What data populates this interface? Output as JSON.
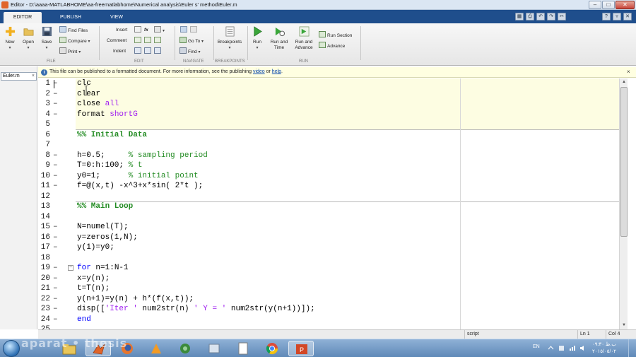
{
  "window": {
    "title": "Editor - D:\\aaaa-MATLABHOME\\aa-freematlabhome\\Numerical analysis\\Euler s' method\\Euler.m",
    "min_glyph": "–",
    "max_glyph": "□",
    "close_glyph": "✕"
  },
  "ribbon": {
    "tabs": [
      "EDITOR",
      "PUBLISH",
      "VIEW"
    ],
    "active_tab": "EDITOR",
    "quick_access_glyphs": [
      "▦",
      "⎙",
      "↶",
      "↷",
      "✂",
      "?",
      "▿",
      "✕"
    ],
    "file": {
      "group_label": "FILE",
      "new": "New",
      "open": "Open",
      "save": "Save",
      "find_files": "Find Files",
      "compare": "Compare",
      "print": "Print"
    },
    "edit": {
      "group_label": "EDIT",
      "insert": "Insert",
      "comment": "Comment",
      "indent": "Indent",
      "fx_glyph": "fx"
    },
    "navigate": {
      "group_label": "NAVIGATE",
      "go_to": "Go To",
      "find": "Find"
    },
    "breakpoints": {
      "group_label": "BREAKPOINTS",
      "breakpoints": "Breakpoints"
    },
    "run": {
      "group_label": "RUN",
      "run": "Run",
      "run_and_time": [
        "Run and",
        "Time"
      ],
      "run_and_advance": [
        "Run and",
        "Advance"
      ],
      "run_section": "Run Section",
      "advance": "Advance"
    },
    "caret": "▾"
  },
  "file_tab": {
    "name": "Euler.m",
    "close": "×"
  },
  "info_bar": {
    "text_before": "This file can be published to a formatted document. For more information, see the publishing ",
    "link1": "video",
    "middle": " or ",
    "link2": "help",
    "end": ".",
    "icon": "i",
    "close": "×"
  },
  "editor": {
    "dash": "–",
    "fold_glyph": "−",
    "lines": [
      {
        "n": "1",
        "dash": true,
        "segs": [
          {
            "t": "clc",
            "c": ""
          }
        ]
      },
      {
        "n": "2",
        "dash": true,
        "segs": [
          {
            "t": "clear",
            "c": ""
          }
        ]
      },
      {
        "n": "3",
        "dash": true,
        "segs": [
          {
            "t": "close ",
            "c": ""
          },
          {
            "t": "all",
            "c": "st"
          }
        ]
      },
      {
        "n": "4",
        "dash": true,
        "segs": [
          {
            "t": "format ",
            "c": ""
          },
          {
            "t": "shortG",
            "c": "st"
          }
        ]
      },
      {
        "n": "5",
        "dash": false,
        "segs": []
      },
      {
        "n": "6",
        "dash": false,
        "segs": [
          {
            "t": "%% Initial Data",
            "c": "sec"
          }
        ]
      },
      {
        "n": "7",
        "dash": false,
        "segs": []
      },
      {
        "n": "8",
        "dash": true,
        "segs": [
          {
            "t": "h=0.5;     ",
            "c": ""
          },
          {
            "t": "% sampling period",
            "c": "cm"
          }
        ]
      },
      {
        "n": "9",
        "dash": true,
        "segs": [
          {
            "t": "T=0:h:100; ",
            "c": ""
          },
          {
            "t": "% t",
            "c": "cm"
          }
        ]
      },
      {
        "n": "10",
        "dash": true,
        "segs": [
          {
            "t": "y0=1;      ",
            "c": ""
          },
          {
            "t": "% initial point",
            "c": "cm"
          }
        ]
      },
      {
        "n": "11",
        "dash": true,
        "segs": [
          {
            "t": "f=@(x,t) -x^3+x*sin( 2*t );",
            "c": ""
          }
        ]
      },
      {
        "n": "12",
        "dash": false,
        "segs": []
      },
      {
        "n": "13",
        "dash": false,
        "segs": [
          {
            "t": "%% Main Loop",
            "c": "sec"
          }
        ]
      },
      {
        "n": "14",
        "dash": false,
        "segs": []
      },
      {
        "n": "15",
        "dash": true,
        "segs": [
          {
            "t": "N=numel(T);",
            "c": ""
          }
        ]
      },
      {
        "n": "16",
        "dash": true,
        "segs": [
          {
            "t": "y=zeros(1,N);",
            "c": ""
          }
        ]
      },
      {
        "n": "17",
        "dash": true,
        "segs": [
          {
            "t": "y(1)=y0;",
            "c": ""
          }
        ]
      },
      {
        "n": "18",
        "dash": false,
        "segs": []
      },
      {
        "n": "19",
        "dash": true,
        "fold": true,
        "segs": [
          {
            "t": "for",
            "c": "kw"
          },
          {
            "t": " n=1:N-1",
            "c": ""
          }
        ]
      },
      {
        "n": "20",
        "dash": true,
        "segs": [
          {
            "t": "x=y(n);",
            "c": ""
          }
        ]
      },
      {
        "n": "21",
        "dash": true,
        "segs": [
          {
            "t": "t=T(n);",
            "c": ""
          }
        ]
      },
      {
        "n": "22",
        "dash": true,
        "segs": [
          {
            "t": "y(n+1)=y(n) + h*(f(x,t));",
            "c": ""
          }
        ]
      },
      {
        "n": "23",
        "dash": true,
        "segs": [
          {
            "t": "disp(['Iter ' num2str(n) ' Y = ' num2str(y(n+1))]);",
            "c": "disp"
          }
        ]
      },
      {
        "n": "24",
        "dash": true,
        "segs": [
          {
            "t": "end",
            "c": "kw"
          }
        ]
      },
      {
        "n": "25",
        "dash": false,
        "segs": []
      }
    ]
  },
  "status_bar": {
    "mode": "script",
    "ln_label": "Ln",
    "ln": "1",
    "col_label": "Col",
    "col": "4"
  },
  "taskbar": {
    "language": "EN",
    "time": "ب.ظ ٠٩:٣٠",
    "date": "٢٠١٥/٠٥/٠٢",
    "watermark": "aparat • thesis"
  },
  "colors": {
    "keyword": "#0000ff",
    "comment": "#228b22",
    "string": "#a020f0",
    "ribbon_tab_bar": "#1f4e8c",
    "cell_highlight": "#fdfde2"
  }
}
